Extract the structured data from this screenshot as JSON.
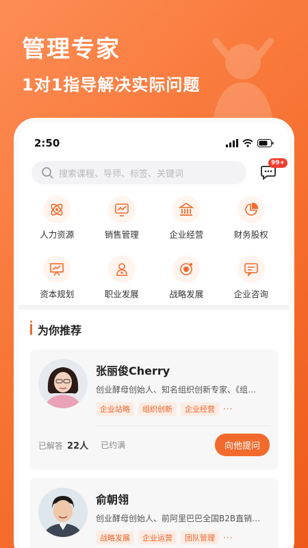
{
  "hero": {
    "title": "管理专家",
    "subtitle": "1对1指导解决实际问题"
  },
  "status_bar": {
    "time": "2:50"
  },
  "search": {
    "placeholder": "搜索课程、导师、标签、关键词"
  },
  "messages": {
    "badge": "99+"
  },
  "categories": [
    {
      "label": "人力资源",
      "icon": "atom-icon"
    },
    {
      "label": "销售管理",
      "icon": "trend-monitor-icon"
    },
    {
      "label": "企业经营",
      "icon": "bank-icon"
    },
    {
      "label": "财务股权",
      "icon": "pie-chart-icon"
    },
    {
      "label": "资本规划",
      "icon": "presentation-chart-icon"
    },
    {
      "label": "职业发展",
      "icon": "user-badge-icon"
    },
    {
      "label": "战略发展",
      "icon": "target-orbit-icon"
    },
    {
      "label": "企业咨询",
      "icon": "chat-bubble-icon"
    }
  ],
  "recommend": {
    "title": "为你推荐",
    "experts": [
      {
        "name": "张丽俊Cherry",
        "desc": "创业酵母创始人、知名组织创新专家、《组…",
        "tags": [
          "企业站略",
          "组织创新",
          "企业经营"
        ],
        "more": "···",
        "answered_label": "已解答",
        "answered_count": "22人",
        "booked_label": "已约满",
        "ask_label": "向他提问"
      },
      {
        "name": "俞朝翎",
        "desc": "创业酵母创始人、前阿里巴巴全国B2B直销…",
        "tags": [
          "战略发展",
          "企业运营",
          "团队管理"
        ],
        "more": "···"
      }
    ]
  },
  "colors": {
    "accent": "#f26a2d",
    "tag_bg": "#fdece3",
    "badge": "#f23d2e"
  }
}
